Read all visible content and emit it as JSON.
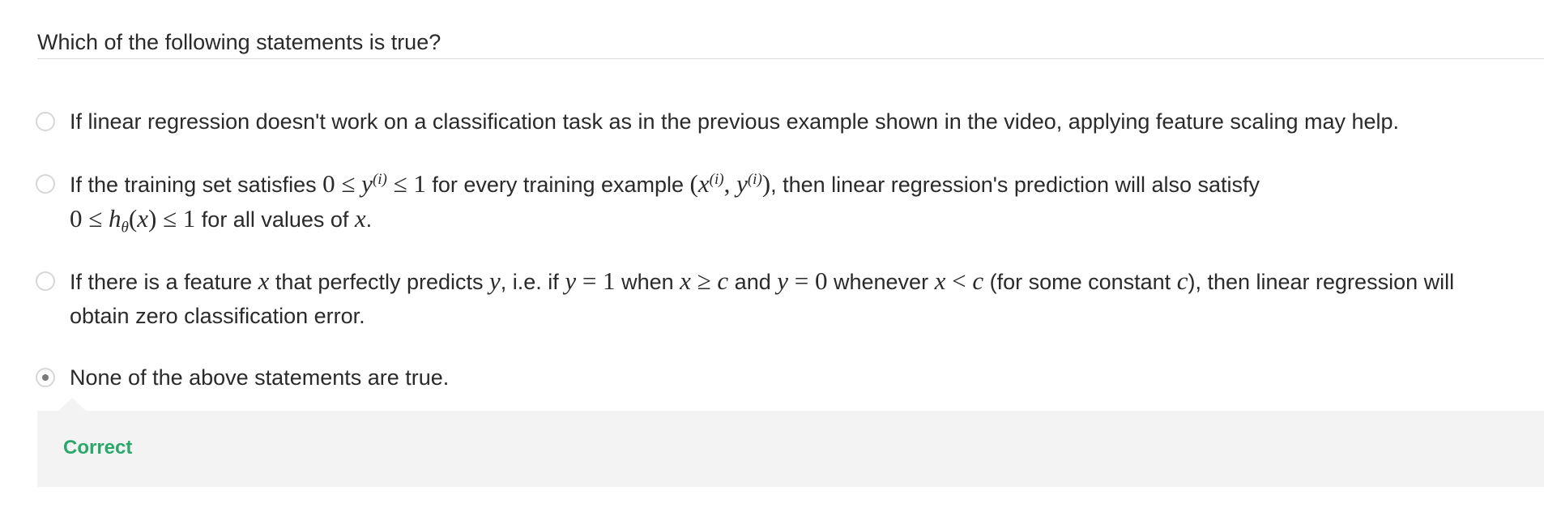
{
  "question": {
    "text": "Which of the following statements is true?"
  },
  "options": [
    {
      "selected": false,
      "t1": "If linear regression doesn't work on a classification task as in the previous example shown in the video, applying feature scaling may help."
    },
    {
      "selected": false,
      "t1": "If the training set satisfies ",
      "m1a": "0 ≤ ",
      "m1b": "y",
      "sup1": "(i)",
      "m1c": " ≤ 1",
      "t2": " for every training example ",
      "m2a": "(",
      "m2b": "x",
      "sup2": "(i)",
      "m2c": ", ",
      "m2d": "y",
      "sup3": "(i)",
      "m2e": ")",
      "t3": ", then linear regression's prediction will also satisfy",
      "m3a": "0 ≤ ",
      "m3b": "h",
      "sub1": "θ",
      "m3c": "(",
      "m3d": "x",
      "m3e": ") ≤ 1",
      "t4": " for all values of ",
      "m4": "x",
      "t5": "."
    },
    {
      "selected": false,
      "t1": "If there is a feature ",
      "m1": "x",
      "t2": " that perfectly predicts ",
      "m2": "y",
      "t3": ", i.e. if ",
      "m3a": "y",
      "m3b": " = 1",
      "t4": " when ",
      "m4a": "x",
      "m4b": " ≥ ",
      "m4c": "c",
      "t5": " and ",
      "m5a": "y",
      "m5b": " = 0",
      "t6": " whenever ",
      "m6a": "x",
      "m6b": " < ",
      "m6c": "c",
      "t7": " (for some constant ",
      "m7": "c",
      "t8": "), then linear regression will obtain zero classification error."
    },
    {
      "selected": true,
      "t1": "None of the above statements are true."
    }
  ],
  "feedback": {
    "label": "Correct"
  },
  "colors": {
    "correct": "#2aa86b",
    "feedback_bg": "#f3f3f3",
    "radio_border": "#d6d6d6"
  }
}
